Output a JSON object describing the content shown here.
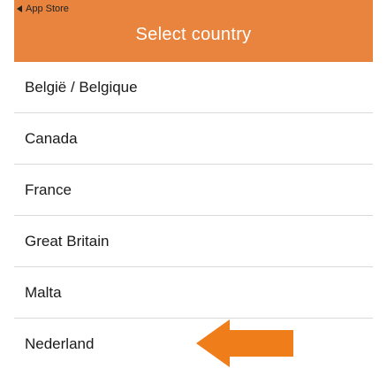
{
  "header": {
    "back_label": "App Store",
    "title": "Select country",
    "color": "#e8843e"
  },
  "countries": [
    {
      "label": "België / Belgique"
    },
    {
      "label": "Canada"
    },
    {
      "label": "France"
    },
    {
      "label": "Great Britain"
    },
    {
      "label": "Malta"
    },
    {
      "label": "Nederland"
    }
  ],
  "annotation": {
    "arrow_icon": "left-arrow-icon",
    "arrow_color": "#ef7d1a",
    "points_to": "Nederland"
  }
}
